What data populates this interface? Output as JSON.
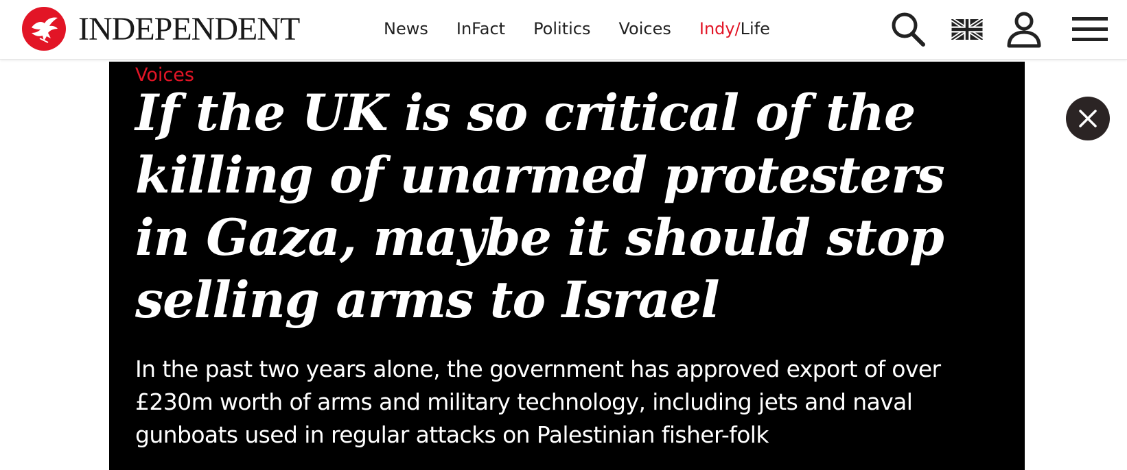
{
  "header": {
    "logo_text": "INDEPENDENT",
    "logo_icon": "eagle-icon",
    "nav": {
      "news": "News",
      "infact": "InFact",
      "politics": "Politics",
      "voices": "Voices",
      "indy_part": "Indy/",
      "life_part": "Life"
    },
    "icons": [
      "search-icon",
      "uk-flag-icon",
      "user-icon",
      "hamburger-menu-icon"
    ]
  },
  "article": {
    "section": "Voices",
    "headline": "If the UK is so critical of the killing of unarmed protesters in Gaza, maybe it should stop selling arms to Israel",
    "standfirst": "In the past two years alone, the government has approved export of over £230m worth of arms and military technology, including jets and naval gunboats used in regular attacks on Palestinian fisher-folk"
  },
  "overlay": {
    "close_icon": "close-icon"
  },
  "colors": {
    "brand_red": "#e21526",
    "hero_background": "#000000",
    "text_dark": "#222222",
    "close_button_bg": "#2b2424"
  }
}
